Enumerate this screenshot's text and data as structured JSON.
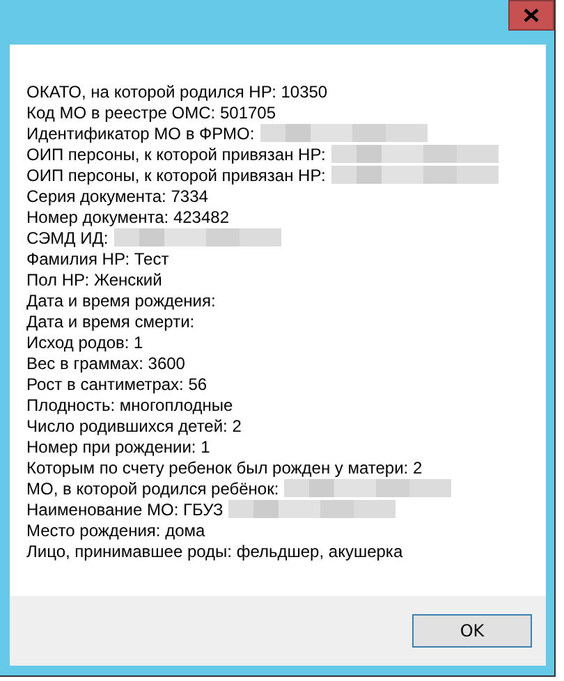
{
  "lines": [
    {
      "text": "ОКАТО, на которой родился НР: 10350",
      "redacted": false
    },
    {
      "text": "Код МО в реестре ОМС: 501705",
      "redacted": false
    },
    {
      "text": "Идентификатор МО в ФРМО:",
      "redacted": true
    },
    {
      "text": "ОИП персоны, к которой привязан НР:",
      "redacted": true
    },
    {
      "text": "ОИП персоны, к которой привязан НР:",
      "redacted": true
    },
    {
      "text": "Серия документа: 7334",
      "redacted": false
    },
    {
      "text": "Номер документа: 423482",
      "redacted": false
    },
    {
      "text": "СЭМД ИД:",
      "redacted": true
    },
    {
      "text": "Фамилия НР: Тест",
      "redacted": false
    },
    {
      "text": "Пол НР: Женский",
      "redacted": false
    },
    {
      "text": "Дата и время рождения:",
      "redacted": false
    },
    {
      "text": "Дата и время смерти:",
      "redacted": false
    },
    {
      "text": "Исход родов: 1",
      "redacted": false
    },
    {
      "text": "Вес в граммах: 3600",
      "redacted": false
    },
    {
      "text": "Рост в сантиметрах: 56",
      "redacted": false
    },
    {
      "text": "Плодность: многоплодные",
      "redacted": false
    },
    {
      "text": "Число родившихся детей: 2",
      "redacted": false
    },
    {
      "text": "Номер при рождении: 1",
      "redacted": false
    },
    {
      "text": "Которым по счету ребенок был рожден у матери: 2",
      "redacted": false
    },
    {
      "text": "МО, в которой родился ребёнок:",
      "redacted": true
    },
    {
      "text": "Наименование МО: ГБУЗ",
      "redacted": true
    },
    {
      "text": "Место рождения: дома",
      "redacted": false
    },
    {
      "text": "Лицо, принимавшее роды: фельдшер, акушерка",
      "redacted": false
    }
  ],
  "buttons": [
    {
      "label": "OK"
    }
  ]
}
